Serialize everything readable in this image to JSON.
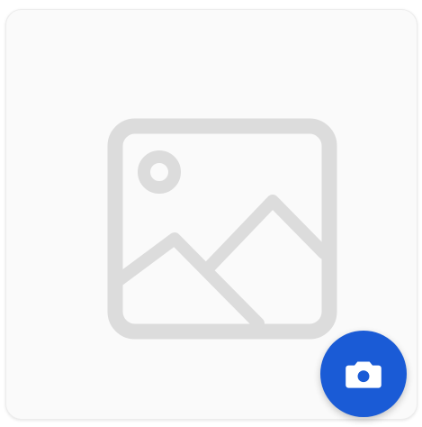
{
  "card": {
    "background": "#fafafa",
    "border": "#ececec"
  },
  "placeholder": {
    "icon": "image-placeholder-icon",
    "color": "#dcdcdc"
  },
  "camera_button": {
    "icon": "camera-icon",
    "background": "#1a5bd6",
    "icon_color": "#ffffff"
  }
}
